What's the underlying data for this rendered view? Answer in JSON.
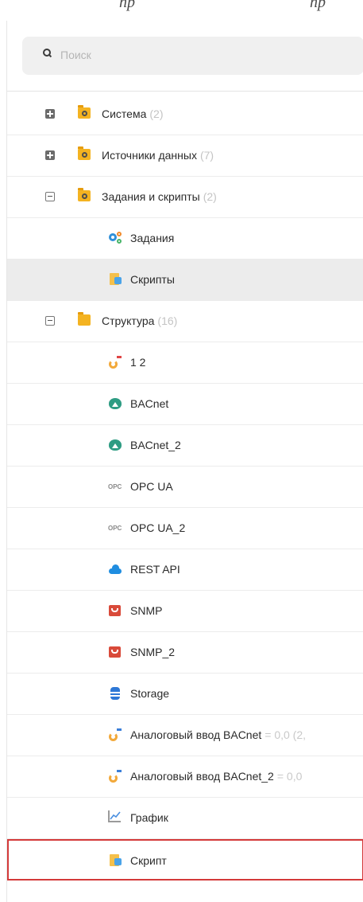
{
  "top_partial_text": "пр                    пр",
  "search": {
    "placeholder": "Поиск"
  },
  "tree": {
    "sistema": {
      "label": "Система",
      "count": "(2)"
    },
    "istochniki": {
      "label": "Источники данных",
      "count": "(7)"
    },
    "zadaniya_skripty": {
      "label": "Задания и скрипты",
      "count": "(2)"
    },
    "zadaniya": {
      "label": "Задания"
    },
    "skripty": {
      "label": "Скрипты"
    },
    "struktura": {
      "label": "Структура",
      "count": "(16)"
    },
    "items": [
      {
        "label": "1 2",
        "icon": "analog-input-icon"
      },
      {
        "label": "BACnet",
        "icon": "bacnet-icon"
      },
      {
        "label": "BACnet_2",
        "icon": "bacnet-icon"
      },
      {
        "label": "OPC UA",
        "icon": "opc-icon"
      },
      {
        "label": "OPC UA_2",
        "icon": "opc-icon"
      },
      {
        "label": "REST API",
        "icon": "cloud-icon"
      },
      {
        "label": "SNMP",
        "icon": "snmp-icon"
      },
      {
        "label": "SNMP_2",
        "icon": "snmp-icon"
      },
      {
        "label": "Storage",
        "icon": "database-icon"
      },
      {
        "label": "Аналоговый ввод BACnet",
        "value": "= 0,0 (2,",
        "icon": "analog-input-icon"
      },
      {
        "label": "Аналоговый ввод BACnet_2",
        "value": "= 0,0",
        "icon": "analog-input-icon"
      },
      {
        "label": "График",
        "icon": "chart-icon"
      },
      {
        "label": "Скрипт",
        "icon": "script-icon"
      }
    ],
    "opc_glyph": "OPC"
  },
  "colors": {
    "folder": "#f4b321",
    "selected_row": "#ececec",
    "highlight_border": "#d43a3a",
    "count_text": "#c4c4c4"
  }
}
